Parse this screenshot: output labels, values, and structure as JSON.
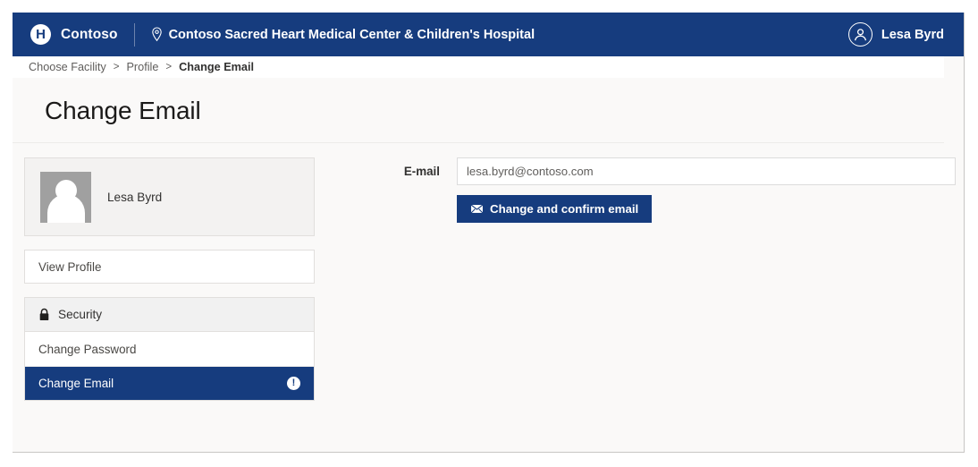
{
  "navbar": {
    "logo_letter": "H",
    "brand": "Contoso",
    "pin_icon": "location-pin-icon",
    "facility": "Contoso Sacred Heart Medical Center & Children's Hospital",
    "user": {
      "name": "Lesa Byrd",
      "avatar_icon": "user-circle-icon"
    },
    "bg_color": "#163c7e"
  },
  "breadcrumb": {
    "items": [
      {
        "label": "Choose Facility",
        "current": false
      },
      {
        "label": "Profile",
        "current": false
      },
      {
        "label": "Change Email",
        "current": true
      }
    ],
    "separator": ">"
  },
  "page": {
    "title": "Change Email"
  },
  "sidebar": {
    "profile": {
      "name": "Lesa Byrd",
      "avatar_icon": "user-photo-placeholder-icon"
    },
    "view_profile": {
      "label": "View Profile"
    },
    "security_group": {
      "header_label": "Security",
      "header_icon": "lock-icon",
      "items": [
        {
          "label": "Change Password",
          "active": false,
          "badge": ""
        },
        {
          "label": "Change Email",
          "active": true,
          "badge": "!",
          "badge_icon": "info-icon"
        }
      ]
    }
  },
  "form": {
    "email_label": "E-mail",
    "email_value": "lesa.byrd@contoso.com",
    "email_placeholder": "lesa.byrd@contoso.com",
    "submit_label": "Change and confirm email",
    "submit_icon": "envelope-icon",
    "accent_color": "#163c7e"
  }
}
